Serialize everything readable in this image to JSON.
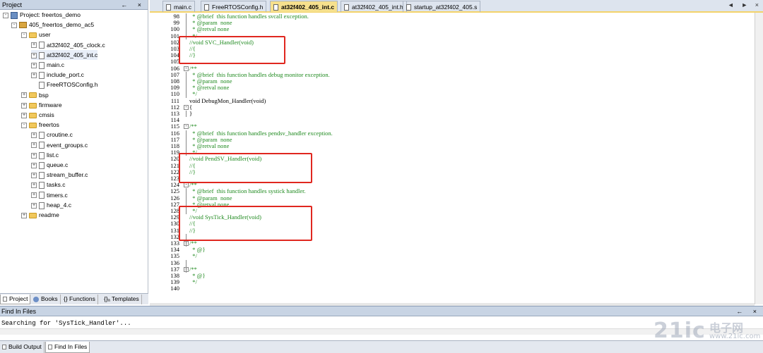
{
  "project_panel": {
    "title": "Project",
    "controls": "← ×",
    "tree": [
      {
        "label": "Project: freertos_demo",
        "kind": "project",
        "level": 0,
        "expander": "-"
      },
      {
        "label": "405_freertos_demo_ac5",
        "kind": "target",
        "level": 1,
        "expander": "-"
      },
      {
        "label": "user",
        "kind": "folder",
        "level": 2,
        "expander": "-"
      },
      {
        "label": "at32f402_405_clock.c",
        "kind": "file",
        "level": 3,
        "expander": "+"
      },
      {
        "label": "at32f402_405_int.c",
        "kind": "file",
        "level": 3,
        "expander": "+",
        "selected": true
      },
      {
        "label": "main.c",
        "kind": "file",
        "level": 3,
        "expander": "+"
      },
      {
        "label": "include_port.c",
        "kind": "file",
        "level": 3,
        "expander": "+"
      },
      {
        "label": "FreeRTOSConfig.h",
        "kind": "file",
        "level": 3,
        "expander": ""
      },
      {
        "label": "bsp",
        "kind": "folder",
        "level": 2,
        "expander": "+"
      },
      {
        "label": "firmware",
        "kind": "folder",
        "level": 2,
        "expander": "+"
      },
      {
        "label": "cmsis",
        "kind": "folder",
        "level": 2,
        "expander": "+"
      },
      {
        "label": "freertos",
        "kind": "folder",
        "level": 2,
        "expander": "-"
      },
      {
        "label": "croutine.c",
        "kind": "file",
        "level": 3,
        "expander": "+"
      },
      {
        "label": "event_groups.c",
        "kind": "file",
        "level": 3,
        "expander": "+"
      },
      {
        "label": "list.c",
        "kind": "file",
        "level": 3,
        "expander": "+"
      },
      {
        "label": "queue.c",
        "kind": "file",
        "level": 3,
        "expander": "+"
      },
      {
        "label": "stream_buffer.c",
        "kind": "file",
        "level": 3,
        "expander": "+"
      },
      {
        "label": "tasks.c",
        "kind": "file",
        "level": 3,
        "expander": "+"
      },
      {
        "label": "timers.c",
        "kind": "file",
        "level": 3,
        "expander": "+"
      },
      {
        "label": "heap_4.c",
        "kind": "file",
        "level": 3,
        "expander": "+"
      },
      {
        "label": "readme",
        "kind": "folder",
        "level": 2,
        "expander": "+"
      }
    ],
    "tabs": [
      "Project",
      "Books",
      "{} Functions",
      "{}ₐ Templates"
    ]
  },
  "editor": {
    "tabs": [
      {
        "label": "main.c",
        "active": false
      },
      {
        "label": "FreeRTOSConfig.h",
        "active": false
      },
      {
        "label": "at32f402_405_int.c",
        "active": true
      },
      {
        "label": "at32f402_405_int.h",
        "active": false
      },
      {
        "label": "startup_at32f402_405.s",
        "active": false
      }
    ],
    "tab_controls": "◄ ► ×",
    "lines": [
      {
        "n": "98",
        "text": "  * @brief  this function handles svcall exception.",
        "c": true
      },
      {
        "n": "99",
        "text": "  * @param  none",
        "c": true
      },
      {
        "n": "100",
        "text": "  * @retval none",
        "c": true
      },
      {
        "n": "101",
        "text": "  */",
        "c": true
      },
      {
        "n": "102",
        "text": "//void SVC_Handler(void)",
        "c": true
      },
      {
        "n": "103",
        "text": "//{",
        "c": true
      },
      {
        "n": "104",
        "text": "//}",
        "c": true
      },
      {
        "n": "105",
        "text": "",
        "c": false
      },
      {
        "n": "106",
        "text": "/**",
        "c": true,
        "fold": "-"
      },
      {
        "n": "107",
        "text": "  * @brief  this function handles debug monitor exception.",
        "c": true
      },
      {
        "n": "108",
        "text": "  * @param  none",
        "c": true
      },
      {
        "n": "109",
        "text": "  * @retval none",
        "c": true
      },
      {
        "n": "110",
        "text": "  */",
        "c": true
      },
      {
        "n": "111",
        "text": "void DebugMon_Handler(void)",
        "c": false
      },
      {
        "n": "112",
        "text": "{",
        "c": false,
        "fold": "-"
      },
      {
        "n": "113",
        "text": "}",
        "c": false
      },
      {
        "n": "114",
        "text": "",
        "c": false
      },
      {
        "n": "115",
        "text": "/**",
        "c": true,
        "fold": "-"
      },
      {
        "n": "116",
        "text": "  * @brief  this function handles pendsv_handler exception.",
        "c": true
      },
      {
        "n": "117",
        "text": "  * @param  none",
        "c": true
      },
      {
        "n": "118",
        "text": "  * @retval none",
        "c": true
      },
      {
        "n": "119",
        "text": "  */",
        "c": true
      },
      {
        "n": "120",
        "text": "//void PendSV_Handler(void)",
        "c": true
      },
      {
        "n": "121",
        "text": "//{",
        "c": true
      },
      {
        "n": "122",
        "text": "//}",
        "c": true
      },
      {
        "n": "123",
        "text": "",
        "c": false
      },
      {
        "n": "124",
        "text": "/**",
        "c": true,
        "fold": "-"
      },
      {
        "n": "125",
        "text": "  * @brief  this function handles systick handler.",
        "c": true
      },
      {
        "n": "126",
        "text": "  * @param  none",
        "c": true
      },
      {
        "n": "127",
        "text": "  * @retval none",
        "c": true
      },
      {
        "n": "128",
        "text": "  */",
        "c": true
      },
      {
        "n": "129",
        "text": "//void SysTick_Handler(void)",
        "c": true
      },
      {
        "n": "130",
        "text": "//{",
        "c": true
      },
      {
        "n": "131",
        "text": "//}",
        "c": true
      },
      {
        "n": "132",
        "text": "",
        "c": false
      },
      {
        "n": "133",
        "text": "/**",
        "c": true,
        "fold": "-"
      },
      {
        "n": "134",
        "text": "  * @}",
        "c": true
      },
      {
        "n": "135",
        "text": "  */",
        "c": true
      },
      {
        "n": "136",
        "text": "",
        "c": false
      },
      {
        "n": "137",
        "text": "/**",
        "c": true,
        "fold": "-"
      },
      {
        "n": "138",
        "text": "  * @}",
        "c": true
      },
      {
        "n": "139",
        "text": "  */",
        "c": true
      },
      {
        "n": "140",
        "text": "",
        "c": false
      }
    ],
    "highlight_color": "#e0271f",
    "comment_color": "#1f8a1f"
  },
  "find_panel": {
    "title": "Find In Files",
    "controls": "← ×",
    "output": "Searching for 'SysTick_Handler'...",
    "tabs": [
      "Build Output",
      "Find In Files"
    ]
  },
  "watermark": {
    "main": "21ic",
    "cn": "电子网",
    "url": "www.21ic.com"
  }
}
